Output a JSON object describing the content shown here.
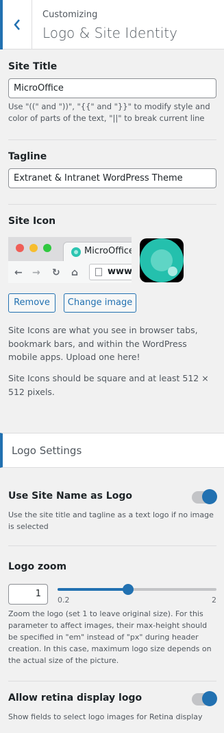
{
  "header": {
    "subtitle": "Customizing",
    "title": "Logo & Site Identity"
  },
  "site_title": {
    "label": "Site Title",
    "value": "MicroOffice",
    "description": "Use \"((\" and \"))\", \"{{\" and \"}}\" to modify style and color of parts of the text, \"||\" to break current line"
  },
  "tagline": {
    "label": "Tagline",
    "value": "Extranet & Intranet WordPress Theme"
  },
  "site_icon": {
    "label": "Site Icon",
    "browser_tab_title": "MicroOffice",
    "browser_url": "www.",
    "remove_label": "Remove",
    "change_label": "Change image",
    "desc1": "Site Icons are what you see in browser tabs, bookmark bars, and within the WordPress mobile apps. Upload one here!",
    "desc2": "Site Icons should be square and at least 512 × 512 pixels."
  },
  "logo_settings": {
    "title": "Logo Settings",
    "use_site_name": {
      "label": "Use Site Name as Logo",
      "description": "Use the site title and tagline as a text logo if no image is selected",
      "enabled": true
    },
    "logo_zoom": {
      "label": "Logo zoom",
      "value": "1",
      "min": "0.2",
      "max": "2",
      "description": "Zoom the logo (set 1 to leave original size). For this parameter to affect images, their max-height should be specified in \"em\" instead of \"px\" during header creation. In this case, maximum logo size depends on the actual size of the picture."
    },
    "retina": {
      "label": "Allow retina display logo",
      "description": "Show fields to select logo images for Retina display",
      "enabled": true
    }
  },
  "colors": {
    "accent": "#2271b1",
    "icon_teal": "#24c0ad"
  }
}
